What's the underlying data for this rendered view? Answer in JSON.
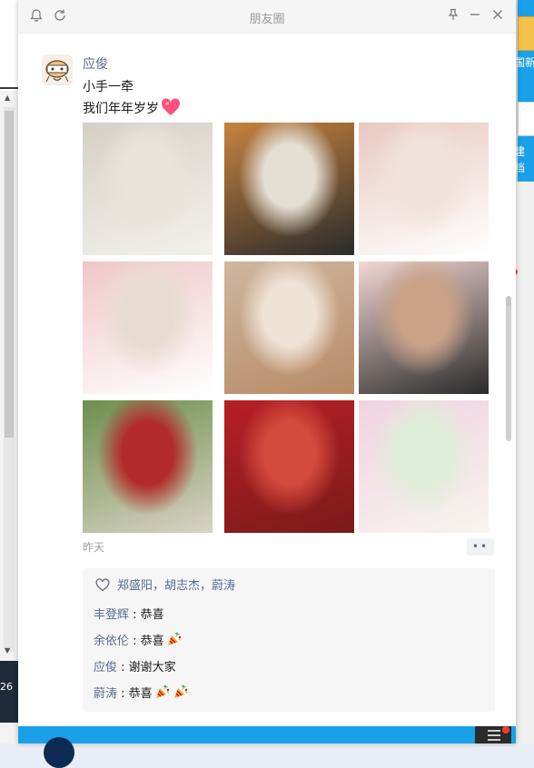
{
  "window": {
    "title": "朋友圈"
  },
  "post": {
    "author": "应俊",
    "lines": [
      "小手一牵",
      "我们年年岁岁"
    ],
    "time": "昨天",
    "more_label": "••",
    "photos": [
      {
        "name": "photo-1",
        "colors": [
          "#d6cfc6",
          "#e9e3da",
          "#f4f1ec"
        ]
      },
      {
        "name": "photo-2",
        "colors": [
          "#c7833e",
          "#e4ded3",
          "#2b2b2b"
        ]
      },
      {
        "name": "photo-3",
        "colors": [
          "#e8c9c0",
          "#f2e2dc",
          "#ffffff"
        ]
      },
      {
        "name": "photo-4",
        "colors": [
          "#f0c6c8",
          "#e8dcd2",
          "#ffffff"
        ]
      },
      {
        "name": "photo-5",
        "colors": [
          "#cfb79f",
          "#efe3d6",
          "#b88a66"
        ]
      },
      {
        "name": "photo-6",
        "colors": [
          "#f3d7d4",
          "#c9a287",
          "#2a2a2a"
        ]
      },
      {
        "name": "photo-7",
        "colors": [
          "#6d8f4c",
          "#b32a2a",
          "#d9d3c4"
        ]
      },
      {
        "name": "photo-8",
        "colors": [
          "#b71f26",
          "#d44a3c",
          "#7b1a1a"
        ]
      },
      {
        "name": "photo-9",
        "colors": [
          "#f1d3e2",
          "#dfeed8",
          "#f7f4ee"
        ]
      }
    ]
  },
  "likes": {
    "names": "郑盛阳，胡志杰，蔚涛"
  },
  "comments": [
    {
      "name": "丰登辉",
      "text": "恭喜",
      "emoji_count": 0
    },
    {
      "name": "余依伦",
      "text": "恭喜",
      "emoji_count": 1
    },
    {
      "name": "应俊",
      "text": "谢谢大家",
      "emoji_count": 0
    },
    {
      "name": "蔚涛",
      "text": "恭喜",
      "emoji_count": 2
    }
  ],
  "background": {
    "left_number": "26",
    "right_labels": [
      "国新",
      "建",
      "档"
    ]
  },
  "colors": {
    "link": "#576b95",
    "accent_blue": "#1aa0e8"
  }
}
